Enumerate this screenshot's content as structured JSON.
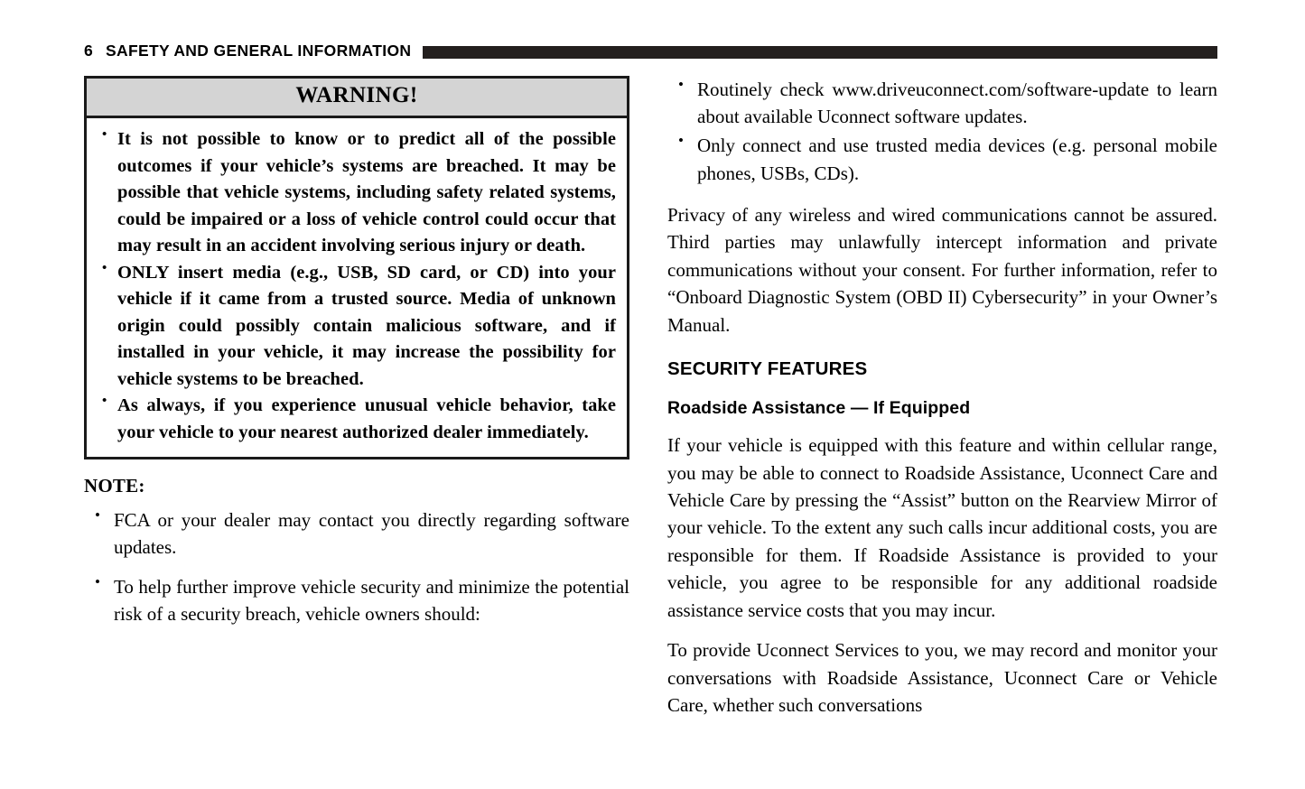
{
  "header": {
    "page_number": "6",
    "title": "SAFETY AND GENERAL INFORMATION"
  },
  "left_column": {
    "warning": {
      "heading": "WARNING!",
      "bullets": [
        "It is not possible to know or to predict all of the possible outcomes if your vehicle’s systems are breached. It may be possible that vehicle systems, including safety related systems, could be impaired or a loss of vehicle control could occur that may result in an accident involving serious injury or death.",
        "ONLY insert media (e.g., USB, SD card, or CD) into your vehicle if it came from a trusted source. Media of unknown origin could possibly contain malicious software, and if installed in your vehicle, it may increase the possibility for vehicle systems to be breached.",
        "As always, if you experience unusual vehicle behavior, take your vehicle to your nearest authorized dealer immediately."
      ]
    },
    "note_label": "NOTE:",
    "note_bullets": [
      "FCA or your dealer may contact you directly regarding software updates.",
      "To help further improve vehicle security and minimize the potential risk of a security breach, vehicle owners should:"
    ]
  },
  "right_column": {
    "bullets": [
      "Routinely check www.driveuconnect.com/software-update to learn about available Uconnect software updates.",
      "Only connect and use trusted media devices (e.g. personal mobile phones, USBs, CDs)."
    ],
    "privacy_paragraph": "Privacy of any wireless and wired communications cannot be assured. Third parties may unlawfully intercept information and private communications without your consent. For further information, refer to “Onboard Diagnostic System (OBD II) Cybersecurity” in your Owner’s Manual.",
    "section_heading": "SECURITY FEATURES",
    "sub_heading": "Roadside Assistance — If Equipped",
    "roadside_paragraph_1": "If your vehicle is equipped with this feature and within cellular range, you may be able to connect to Roadside Assistance, Uconnect Care and Vehicle Care by pressing the “Assist” button on the Rearview Mirror of your vehicle. To the extent any such calls incur additional costs, you are responsible for them. If Roadside Assistance is provided to your vehicle, you agree to be responsible for any additional roadside assistance service costs that you may incur.",
    "roadside_paragraph_2": "To provide Uconnect Services to you, we may record and monitor your conversations with Roadside Assistance, Uconnect Care or Vehicle Care, whether such conversations"
  },
  "colors": {
    "rule": "#231f1e",
    "warning_header_fill": "#d4d4d4",
    "border": "#1a1a1a",
    "text": "#000000"
  }
}
